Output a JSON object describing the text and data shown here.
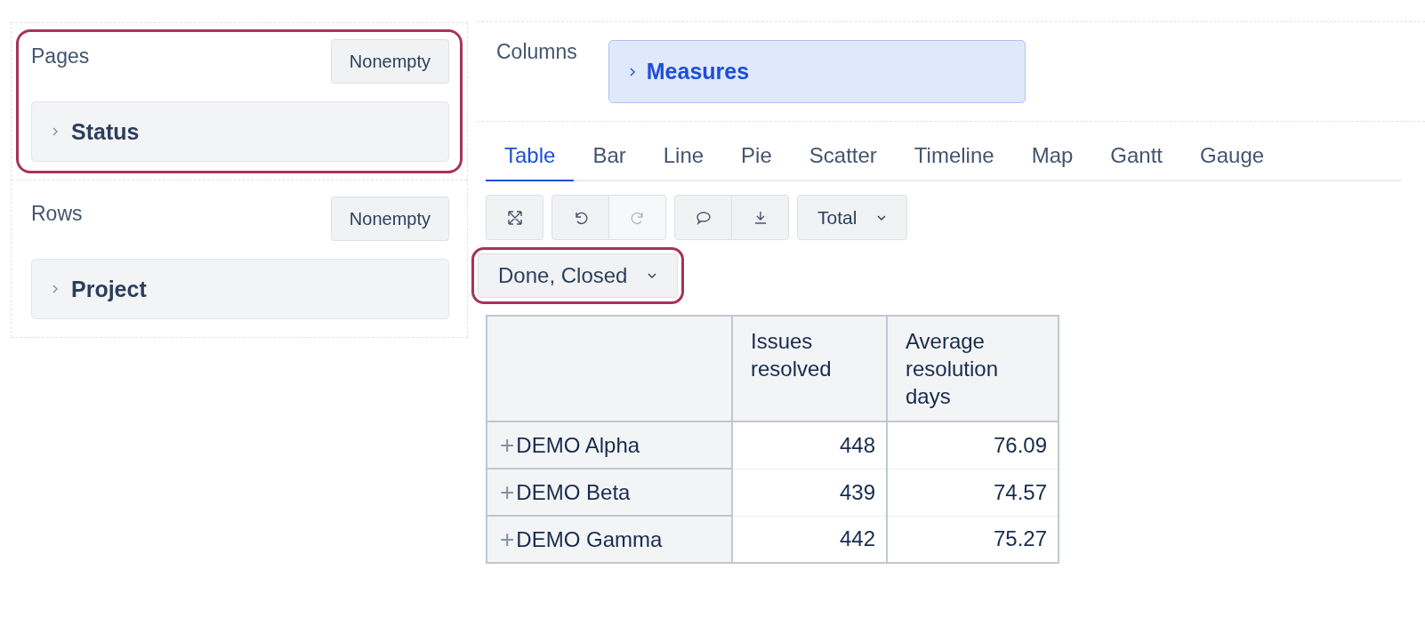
{
  "sections": [
    {
      "label": "Pages",
      "button": "Nonempty",
      "highlighted": true,
      "items": [
        {
          "label": "Status",
          "expanded": false
        }
      ]
    },
    {
      "label": "Rows",
      "button": "Nonempty",
      "highlighted": false,
      "items": [
        {
          "label": "Project",
          "expanded": false
        }
      ]
    }
  ],
  "columns": {
    "label": "Columns",
    "items": [
      {
        "label": "Measures",
        "expanded": false
      }
    ]
  },
  "tabs": [
    {
      "label": "Table",
      "selected": true
    },
    {
      "label": "Bar",
      "selected": false
    },
    {
      "label": "Line",
      "selected": false
    },
    {
      "label": "Pie",
      "selected": false
    },
    {
      "label": "Scatter",
      "selected": false
    },
    {
      "label": "Timeline",
      "selected": false
    },
    {
      "label": "Map",
      "selected": false
    },
    {
      "label": "Gantt",
      "selected": false
    },
    {
      "label": "Gauge",
      "selected": false
    }
  ],
  "toolbar": [
    [
      {
        "kind": "expand",
        "disabled": false
      }
    ],
    [
      {
        "kind": "undo",
        "disabled": false
      },
      {
        "kind": "redo",
        "disabled": true
      }
    ],
    [
      {
        "kind": "comment",
        "disabled": false
      },
      {
        "kind": "download",
        "disabled": false
      }
    ],
    [
      {
        "kind": "dropdown",
        "label": "Total"
      }
    ]
  ],
  "filter": {
    "label": "Done, Closed",
    "highlighted": true
  },
  "table": {
    "columns": [
      "Issues resolved",
      "Average resolution days"
    ],
    "rows": [
      {
        "label": "DEMO Alpha",
        "expand": "+",
        "values": [
          "448",
          "76.09"
        ]
      },
      {
        "label": "DEMO Beta",
        "expand": "+",
        "values": [
          "439",
          "74.57"
        ]
      },
      {
        "label": "DEMO Gamma",
        "expand": "+",
        "values": [
          "442",
          "75.27"
        ]
      }
    ]
  }
}
